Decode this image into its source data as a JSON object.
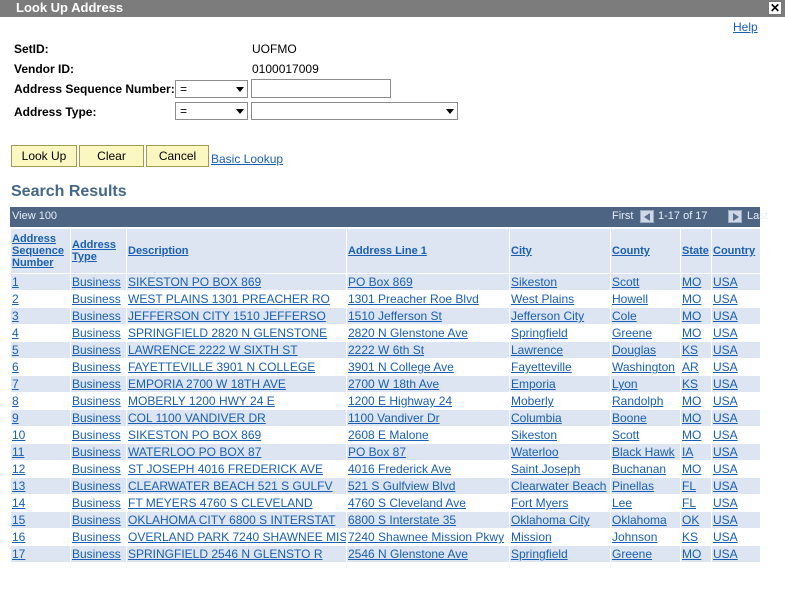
{
  "window": {
    "title": "Look Up Address",
    "close_glyph": "✕"
  },
  "help_label": "Help",
  "form": {
    "setid_label": "SetID:",
    "setid_value": "UOFMO",
    "vendor_label": "Vendor ID:",
    "vendor_value": "0100017009",
    "seq_label": "Address Sequence Number:",
    "seq_operator": "=",
    "seq_value": "",
    "type_label": "Address Type:",
    "type_operator": "=",
    "type_value": ""
  },
  "buttons": {
    "lookup": "Look Up",
    "clear": "Clear",
    "cancel": "Cancel",
    "basic_lookup": "Basic Lookup"
  },
  "results": {
    "title": "Search Results",
    "view_label": "View 100",
    "first_label": "First",
    "range_label": "1-17 of 17",
    "last_label": "Last",
    "columns": [
      "Address Sequence Number",
      "Address Type",
      "Description",
      "Address Line 1",
      "City",
      "County",
      "State",
      "Country"
    ],
    "rows": [
      [
        "1",
        "Business",
        "SIKESTON PO BOX 869",
        "PO Box 869",
        "Sikeston",
        "Scott",
        "MO",
        "USA"
      ],
      [
        "2",
        "Business",
        "WEST PLAINS 1301 PREACHER RO",
        "1301 Preacher Roe Blvd",
        "West Plains",
        "Howell",
        "MO",
        "USA"
      ],
      [
        "3",
        "Business",
        "JEFFERSON CITY 1510 JEFFERSO",
        "1510 Jefferson St",
        "Jefferson City",
        "Cole",
        "MO",
        "USA"
      ],
      [
        "4",
        "Business",
        "SPRINGFIELD 2820 N GLENSTONE",
        "2820 N Glenstone Ave",
        "Springfield",
        "Greene",
        "MO",
        "USA"
      ],
      [
        "5",
        "Business",
        "LAWRENCE 2222 W SIXTH ST",
        "2222 W 6th St",
        "Lawrence",
        "Douglas",
        "KS",
        "USA"
      ],
      [
        "6",
        "Business",
        "FAYETTEVILLE 3901 N COLLEGE",
        "3901 N College Ave",
        "Fayetteville",
        "Washington",
        "AR",
        "USA"
      ],
      [
        "7",
        "Business",
        "EMPORIA 2700 W 18TH AVE",
        "2700 W 18th Ave",
        "Emporia",
        "Lyon",
        "KS",
        "USA"
      ],
      [
        "8",
        "Business",
        "MOBERLY 1200 HWY 24 E",
        "1200 E Highway 24",
        "Moberly",
        "Randolph",
        "MO",
        "USA"
      ],
      [
        "9",
        "Business",
        "COL 1100 VANDIVER DR",
        "1100 Vandiver Dr",
        "Columbia",
        "Boone",
        "MO",
        "USA"
      ],
      [
        "10",
        "Business",
        "SIKESTON PO BOX 869",
        "2608 E Malone",
        "Sikeston",
        "Scott",
        "MO",
        "USA"
      ],
      [
        "11",
        "Business",
        "WATERLOO PO BOX 87",
        "PO Box 87",
        "Waterloo",
        "Black Hawk",
        "IA",
        "USA"
      ],
      [
        "12",
        "Business",
        "ST JOSEPH 4016 FREDERICK AVE",
        "4016 Frederick Ave",
        "Saint Joseph",
        "Buchanan",
        "MO",
        "USA"
      ],
      [
        "13",
        "Business",
        "CLEARWATER BEACH 521 S GULFV",
        "521 S Gulfview Blvd",
        "Clearwater Beach",
        "Pinellas",
        "FL",
        "USA"
      ],
      [
        "14",
        "Business",
        "FT MEYERS 4760 S CLEVELAND",
        "4760 S Cleveland Ave",
        "Fort Myers",
        "Lee",
        "FL",
        "USA"
      ],
      [
        "15",
        "Business",
        "OKLAHOMA CITY 6800 S INTERSTAT",
        "6800 S Interstate 35",
        "Oklahoma City",
        "Oklahoma",
        "OK",
        "USA"
      ],
      [
        "16",
        "Business",
        "OVERLAND PARK 7240 SHAWNEE MIS",
        "7240 Shawnee Mission Pkwy",
        "Mission",
        "Johnson",
        "KS",
        "USA"
      ],
      [
        "17",
        "Business",
        "SPRINGFIELD 2546 N GLENSTO R",
        "2546 N Glenstone Ave",
        "Springfield",
        "Greene",
        "MO",
        "USA"
      ]
    ]
  }
}
